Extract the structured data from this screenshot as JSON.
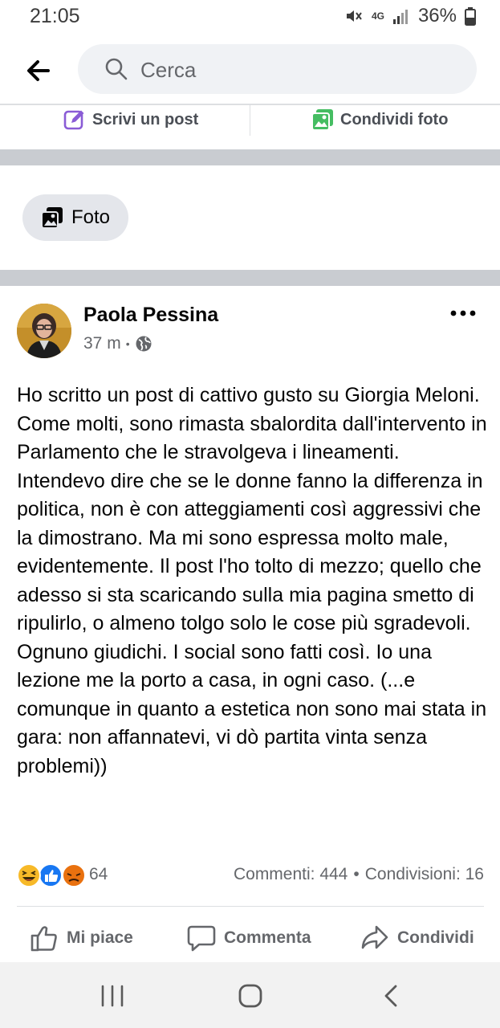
{
  "status_bar": {
    "time": "21:05",
    "network": "4G",
    "battery": "36%"
  },
  "search": {
    "placeholder": "Cerca"
  },
  "composer": {
    "write_post": "Scrivi un post",
    "share_photo": "Condividi foto"
  },
  "filter": {
    "photo_label": "Foto"
  },
  "post": {
    "author": "Paola Pessina",
    "time_ago": "37 m",
    "separator": "•",
    "text": "Ho scritto un post di cattivo gusto su Giorgia Meloni. Come molti, sono rimasta sbalordita dall'intervento in Parlamento che le stravolgeva i lineamenti. Intendevo dire che se le donne fanno la differenza in politica, non è con atteggiamenti così aggressivi che la dimostrano. Ma mi sono espressa molto male, evidentemente. Il post l'ho tolto di mezzo; quello che adesso si sta scaricando sulla mia pagina smetto di ripulirlo, o almeno tolgo solo le cose più sgradevoli. Ognuno giudichi. I social sono fatti così. Io una lezione me la porto a casa, in ogni caso. (...e comunque in quanto a estetica  non sono mai stata in gara: non affannatevi, vi dò partita vinta senza problemi))",
    "reaction_count": "64",
    "comments": "Commenti: 444",
    "stats_separator": "•",
    "shares": "Condivisioni: 16"
  },
  "actions": {
    "like": "Mi piace",
    "comment": "Commenta",
    "share": "Condividi"
  },
  "colors": {
    "facebook_blue": "#1877f2",
    "write_icon": "#8a5cd6",
    "photo_icon": "#45bd62",
    "angry": "#e9710f",
    "haha": "#f7b928",
    "divider_band": "#c9ccd1"
  }
}
